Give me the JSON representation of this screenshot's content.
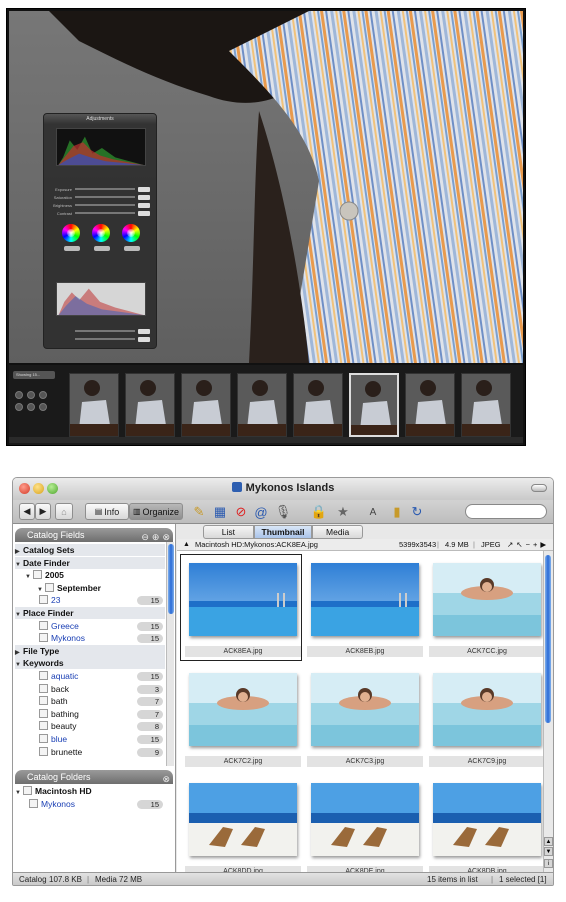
{
  "aperture": {
    "adjustments_title": "Adjustments",
    "adjust_rows": [
      "Exposure",
      "Saturation",
      "Brightness",
      "Contrast"
    ],
    "browse_menu": "Showing 15..."
  },
  "window": {
    "title": "Mykonos Islands",
    "toolbar": {
      "info_label": "Info",
      "organize_label": "Organize"
    }
  },
  "catalog_fields": {
    "header": "Catalog Fields",
    "rows": [
      {
        "label": "Catalog Sets",
        "type": "section",
        "count": ""
      },
      {
        "label": "Date Finder",
        "type": "section",
        "count": ""
      },
      {
        "label": "2005",
        "type": "item-bold",
        "count": ""
      },
      {
        "label": "September",
        "type": "item-bold",
        "count": ""
      },
      {
        "label": "23",
        "type": "item-blue",
        "count": "15"
      },
      {
        "label": "Place Finder",
        "type": "section",
        "count": ""
      },
      {
        "label": "Greece",
        "type": "item-blue",
        "count": "15"
      },
      {
        "label": "Mykonos",
        "type": "item-blue",
        "count": "15"
      },
      {
        "label": "File Type",
        "type": "section",
        "count": ""
      },
      {
        "label": "Keywords",
        "type": "section",
        "count": ""
      },
      {
        "label": "aquatic",
        "type": "item-blue",
        "count": "15"
      },
      {
        "label": "back",
        "type": "item",
        "count": "3"
      },
      {
        "label": "bath",
        "type": "item",
        "count": "7"
      },
      {
        "label": "bathing",
        "type": "item",
        "count": "7"
      },
      {
        "label": "beauty",
        "type": "item",
        "count": "8"
      },
      {
        "label": "blue",
        "type": "item-blue",
        "count": "15"
      },
      {
        "label": "brunette",
        "type": "item",
        "count": "9"
      }
    ]
  },
  "catalog_folders": {
    "header": "Catalog Folders",
    "rows": [
      {
        "label": "Macintosh HD",
        "count": ""
      },
      {
        "label": "Mykonos",
        "count": "15"
      }
    ]
  },
  "tabs": [
    "List",
    "Thumbnail",
    "Media"
  ],
  "active_tab": "Thumbnail",
  "pathbar": {
    "path": "Macintosh HD:Mykonos:ACK8EA.jpg",
    "dimensions": "5399x3543",
    "size": "4.9 MB",
    "format": "JPEG"
  },
  "thumbnails": [
    {
      "caption": "ACK8EA.jpg",
      "scene": "pool"
    },
    {
      "caption": "ACK8EB.jpg",
      "scene": "pool"
    },
    {
      "caption": "ACK7CC.jpg",
      "scene": "swimmer"
    },
    {
      "caption": "ACK7C2.jpg",
      "scene": "swimmer"
    },
    {
      "caption": "ACK7C3.jpg",
      "scene": "swimmer"
    },
    {
      "caption": "ACK7C9.jpg",
      "scene": "swimmer"
    },
    {
      "caption": "ACK8DD.jpg",
      "scene": "chairs"
    },
    {
      "caption": "ACK8DE.jpg",
      "scene": "chairs"
    },
    {
      "caption": "ACK8DB.jpg",
      "scene": "chairs"
    }
  ],
  "status": {
    "catalog": "Catalog",
    "catalog_size": "107.8 KB",
    "media": "Media 72 MB",
    "items": "15 items in list",
    "selected": "1 selected [1]"
  },
  "colors": {
    "accent_blue": "#2a6ad6",
    "link_blue": "#1a3fb4",
    "sea": "#1f7fd0"
  }
}
